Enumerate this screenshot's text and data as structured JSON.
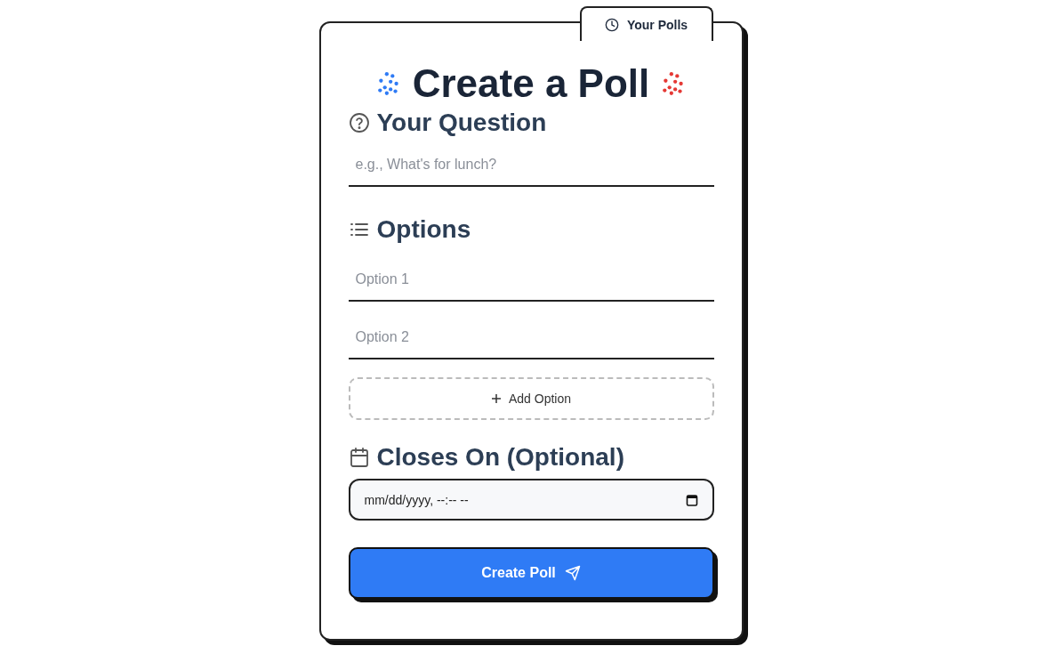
{
  "tab": {
    "label": "Your Polls"
  },
  "title": "Create a Poll",
  "question": {
    "heading": "Your Question",
    "placeholder": "e.g., What's for lunch?"
  },
  "options": {
    "heading": "Options",
    "fields": [
      {
        "placeholder": "Option 1"
      },
      {
        "placeholder": "Option 2"
      }
    ],
    "add_button": "Add Option"
  },
  "closes_on": {
    "heading": "Closes On (Optional)",
    "value": "mm/dd/yyyy, --:-- --"
  },
  "submit_button": "Create Poll"
}
